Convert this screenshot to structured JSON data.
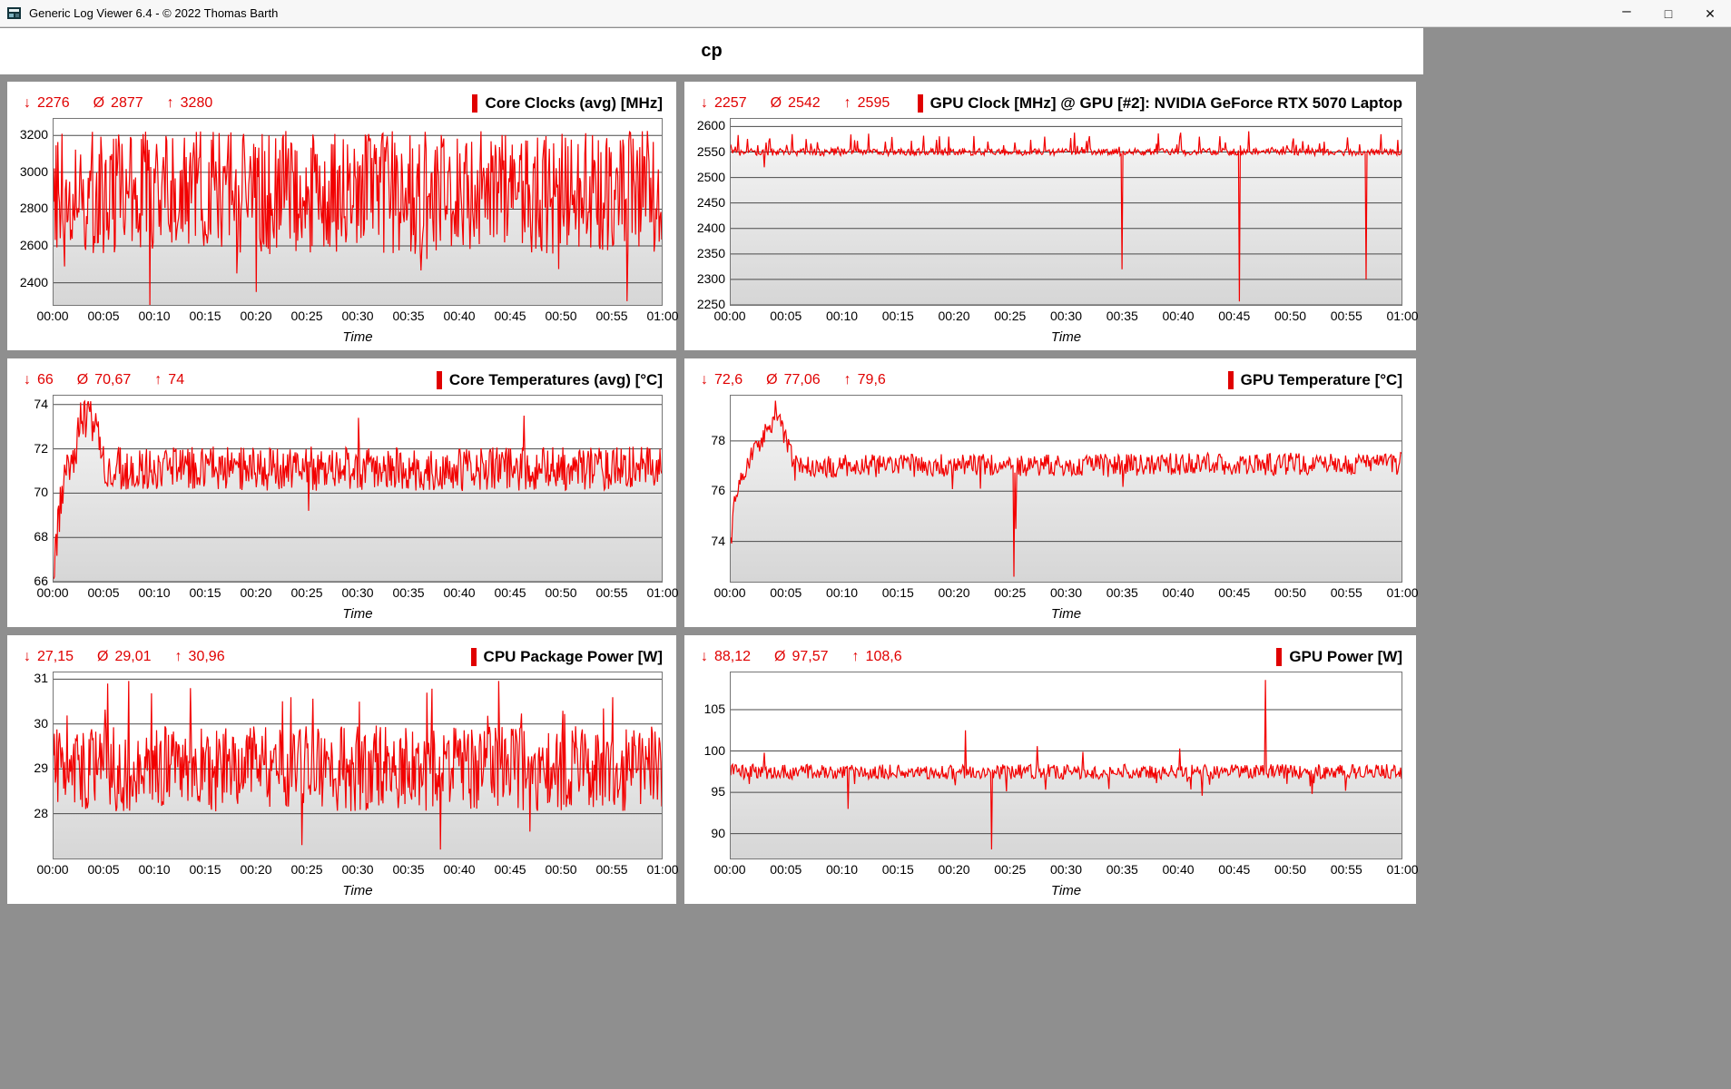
{
  "window": {
    "title": "Generic Log Viewer 6.4 - © 2022 Thomas Barth",
    "controls": {
      "minimize": "–",
      "maximize": "□",
      "close": "✕"
    }
  },
  "header": {
    "title": "cp"
  },
  "symbols": {
    "min": "↓",
    "avg": "Ø",
    "max": "↑"
  },
  "colors": {
    "accent": "#e00000",
    "series": "#f20000",
    "gutter": "#8f8f8f",
    "area_top": "#f5f5f5",
    "area_bottom": "#d6d6d6",
    "gridline": "#4a4a4a"
  },
  "x_axis": {
    "label": "Time",
    "ticks": [
      "00:00",
      "00:05",
      "00:10",
      "00:15",
      "00:20",
      "00:25",
      "00:30",
      "00:35",
      "00:40",
      "00:45",
      "00:50",
      "00:55",
      "01:00"
    ]
  },
  "chart_data": [
    {
      "type": "line",
      "title": "Core Clocks (avg) [MHz]",
      "stats": {
        "min": "2276",
        "avg": "2877",
        "max": "3280"
      },
      "xlabel": "Time",
      "ylim": [
        2280,
        3290
      ],
      "y_ticks": [
        2400,
        2600,
        2800,
        3000,
        3200
      ],
      "series_profile": {
        "baseline": [
          [
            0,
            2890
          ],
          [
            60,
            2890
          ]
        ],
        "noise": 335,
        "burst": [
          0.03,
          -260
        ],
        "spikes": [
          [
            9.5,
            2276
          ],
          [
            20,
            2350
          ],
          [
            56.6,
            2300
          ]
        ],
        "clamp": [
          2276,
          3280
        ]
      }
    },
    {
      "type": "line",
      "title": "GPU Clock [MHz] @ GPU [#2]: NVIDIA GeForce RTX 5070 Laptop",
      "stats": {
        "min": "2257",
        "avg": "2542",
        "max": "2595"
      },
      "xlabel": "Time",
      "ylim": [
        2250,
        2615
      ],
      "y_ticks": [
        2250,
        2300,
        2350,
        2400,
        2450,
        2500,
        2550,
        2600
      ],
      "series_profile": {
        "baseline": [
          [
            0,
            2550
          ],
          [
            60,
            2550
          ]
        ],
        "noise": 7,
        "burst": [
          0.12,
          38
        ],
        "spikes": [
          [
            3,
            2520
          ],
          [
            35,
            2320
          ],
          [
            45.5,
            2257
          ],
          [
            56.8,
            2300
          ]
        ],
        "clamp": [
          2257,
          2595
        ]
      }
    },
    {
      "type": "line",
      "title": "Core Temperatures (avg) [°C]",
      "stats": {
        "min": "66",
        "avg": "70,67",
        "max": "74"
      },
      "xlabel": "Time",
      "ylim": [
        66,
        74.4
      ],
      "y_ticks": [
        66,
        68,
        70,
        72,
        74
      ],
      "series_profile": {
        "baseline": [
          [
            0,
            66.2
          ],
          [
            0.4,
            68.5
          ],
          [
            1.2,
            71
          ],
          [
            2.2,
            72
          ],
          [
            2.6,
            73.2
          ],
          [
            3.6,
            73.6
          ],
          [
            4.3,
            72.6
          ],
          [
            5,
            71.1
          ],
          [
            60,
            71.1
          ]
        ],
        "noise": 1.0,
        "burst": [
          0.0,
          0
        ],
        "spikes": [
          [
            3.0,
            74.1
          ],
          [
            3.3,
            74.0
          ],
          [
            25.2,
            69.2
          ],
          [
            30.1,
            73.4
          ],
          [
            46.4,
            73.5
          ]
        ],
        "clamp": [
          66,
          74.15
        ]
      }
    },
    {
      "type": "line",
      "title": "GPU Temperature [°C]",
      "stats": {
        "min": "72,6",
        "avg": "77,06",
        "max": "79,6"
      },
      "xlabel": "Time",
      "ylim": [
        72.4,
        79.8
      ],
      "y_ticks": [
        74,
        76,
        78
      ],
      "series_profile": {
        "baseline": [
          [
            0,
            73.8
          ],
          [
            0.4,
            75.8
          ],
          [
            0.8,
            76.3
          ],
          [
            1.6,
            77.2
          ],
          [
            2.6,
            77.9
          ],
          [
            3.4,
            78.6
          ],
          [
            4.2,
            78.9
          ],
          [
            4.8,
            78.2
          ],
          [
            5.6,
            77.3
          ],
          [
            7,
            77.0
          ],
          [
            60,
            77.1
          ]
        ],
        "noise": 0.45,
        "burst": [
          0.02,
          -1.2
        ],
        "spikes": [
          [
            4.0,
            79.6
          ],
          [
            25.3,
            72.6
          ],
          [
            25.5,
            74.5
          ]
        ],
        "clamp": [
          72.6,
          79.6
        ]
      }
    },
    {
      "type": "line",
      "title": "CPU Package Power [W]",
      "stats": {
        "min": "27,15",
        "avg": "29,01",
        "max": "30,96"
      },
      "xlabel": "Time",
      "ylim": [
        27.0,
        31.15
      ],
      "y_ticks": [
        28,
        29,
        30,
        31
      ],
      "series_profile": {
        "baseline": [
          [
            0,
            29.0
          ],
          [
            60,
            29.0
          ]
        ],
        "noise": 0.95,
        "burst": [
          0.04,
          1.4
        ],
        "spikes": [
          [
            5.3,
            30.9
          ],
          [
            13.5,
            30.8
          ],
          [
            23.4,
            30.6
          ],
          [
            24.5,
            27.3
          ],
          [
            30.2,
            30.5
          ],
          [
            36.8,
            30.7
          ],
          [
            38.2,
            27.2
          ],
          [
            47.0,
            27.6
          ],
          [
            55.2,
            30.6
          ]
        ],
        "clamp": [
          27.15,
          30.96
        ]
      }
    },
    {
      "type": "line",
      "title": "GPU Power [W]",
      "stats": {
        "min": "88,12",
        "avg": "97,57",
        "max": "108,6"
      },
      "xlabel": "Time",
      "ylim": [
        87.0,
        109.5
      ],
      "y_ticks": [
        90,
        95,
        100,
        105
      ],
      "series_profile": {
        "baseline": [
          [
            0,
            97.5
          ],
          [
            60,
            97.5
          ]
        ],
        "noise": 0.9,
        "burst": [
          0.03,
          -2.5
        ],
        "spikes": [
          [
            3,
            99.8
          ],
          [
            10.5,
            93.0
          ],
          [
            21,
            102.5
          ],
          [
            23.3,
            88.1
          ],
          [
            27.4,
            100.6
          ],
          [
            31.5,
            99.9
          ],
          [
            40.2,
            100.3
          ],
          [
            47.8,
            108.6
          ],
          [
            52,
            94.8
          ],
          [
            55,
            95.2
          ]
        ],
        "clamp": [
          88.12,
          108.6
        ]
      }
    }
  ]
}
